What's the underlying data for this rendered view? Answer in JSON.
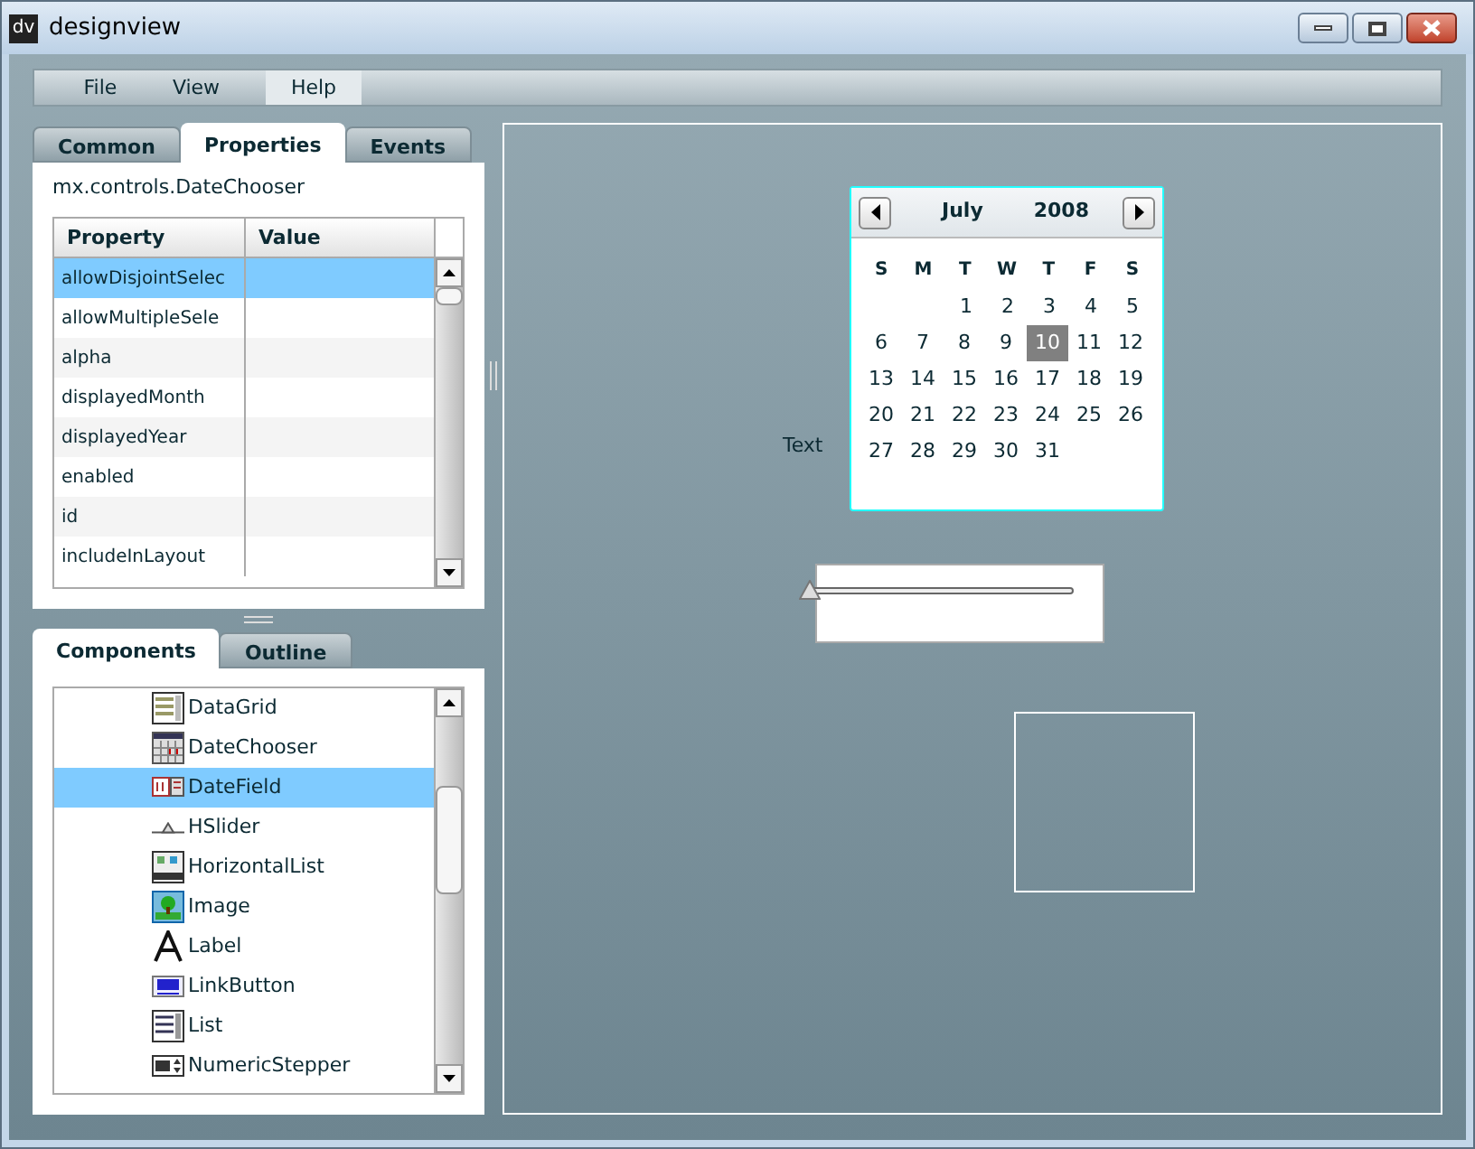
{
  "window": {
    "title": "designview",
    "logo": "dv"
  },
  "menu": [
    {
      "label": "File",
      "selected": false
    },
    {
      "label": "View",
      "selected": false
    },
    {
      "label": "Help",
      "selected": true
    }
  ],
  "top_tabs": [
    {
      "label": "Common",
      "selected": false
    },
    {
      "label": "Properties",
      "selected": true
    },
    {
      "label": "Events",
      "selected": false
    }
  ],
  "properties": {
    "component": "mx.controls.DateChooser",
    "columns": [
      "Property",
      "Value"
    ],
    "rows": [
      {
        "name": "allowDisjointSelec",
        "selected": true
      },
      {
        "name": "allowMultipleSele",
        "selected": false
      },
      {
        "name": "alpha",
        "selected": false
      },
      {
        "name": "displayedMonth",
        "selected": false
      },
      {
        "name": "displayedYear",
        "selected": false
      },
      {
        "name": "enabled",
        "selected": false
      },
      {
        "name": "id",
        "selected": false
      },
      {
        "name": "includeInLayout",
        "selected": false
      }
    ]
  },
  "bottom_tabs": [
    {
      "label": "Components",
      "selected": true
    },
    {
      "label": "Outline",
      "selected": false
    }
  ],
  "components": [
    {
      "label": "DataGrid",
      "kind": "datagrid",
      "selected": false
    },
    {
      "label": "DateChooser",
      "kind": "datechooser",
      "selected": false
    },
    {
      "label": "DateField",
      "kind": "datefield",
      "selected": true
    },
    {
      "label": "HSlider",
      "kind": "hslider",
      "selected": false
    },
    {
      "label": "HorizontalList",
      "kind": "horizontallist",
      "selected": false
    },
    {
      "label": "Image",
      "kind": "image",
      "selected": false
    },
    {
      "label": "Label",
      "kind": "label",
      "selected": false
    },
    {
      "label": "LinkButton",
      "kind": "linkbutton",
      "selected": false
    },
    {
      "label": "List",
      "kind": "list",
      "selected": false
    },
    {
      "label": "NumericStepper",
      "kind": "numericstepper",
      "selected": false
    }
  ],
  "canvas": {
    "text_label": "Text",
    "calendar": {
      "month": "July",
      "year": "2008",
      "weekdays": [
        "S",
        "M",
        "T",
        "W",
        "T",
        "F",
        "S"
      ],
      "weeks": [
        {
          "kind": "first",
          "days": [
            {
              "day": "1",
              "selected": false
            },
            {
              "day": "2",
              "selected": false
            },
            {
              "day": "3",
              "selected": false
            },
            {
              "day": "4",
              "selected": false
            },
            {
              "day": "5",
              "selected": false
            }
          ]
        },
        {
          "kind": "full",
          "days": [
            {
              "day": "6",
              "selected": false
            },
            {
              "day": "7",
              "selected": false
            },
            {
              "day": "8",
              "selected": false
            },
            {
              "day": "9",
              "selected": false
            },
            {
              "day": "10",
              "selected": true
            },
            {
              "day": "11",
              "selected": false
            },
            {
              "day": "12",
              "selected": false
            }
          ]
        },
        {
          "kind": "full",
          "days": [
            {
              "day": "13",
              "selected": false
            },
            {
              "day": "14",
              "selected": false
            },
            {
              "day": "15",
              "selected": false
            },
            {
              "day": "16",
              "selected": false
            },
            {
              "day": "17",
              "selected": false
            },
            {
              "day": "18",
              "selected": false
            },
            {
              "day": "19",
              "selected": false
            }
          ]
        },
        {
          "kind": "full",
          "days": [
            {
              "day": "20",
              "selected": false
            },
            {
              "day": "21",
              "selected": false
            },
            {
              "day": "22",
              "selected": false
            },
            {
              "day": "23",
              "selected": false
            },
            {
              "day": "24",
              "selected": false
            },
            {
              "day": "25",
              "selected": false
            },
            {
              "day": "26",
              "selected": false
            }
          ]
        },
        {
          "kind": "last",
          "days": [
            {
              "day": "27",
              "selected": false
            },
            {
              "day": "28",
              "selected": false
            },
            {
              "day": "29",
              "selected": false
            },
            {
              "day": "30",
              "selected": false
            },
            {
              "day": "31",
              "selected": false
            }
          ]
        }
      ]
    },
    "slider": {
      "level": 0
    }
  }
}
